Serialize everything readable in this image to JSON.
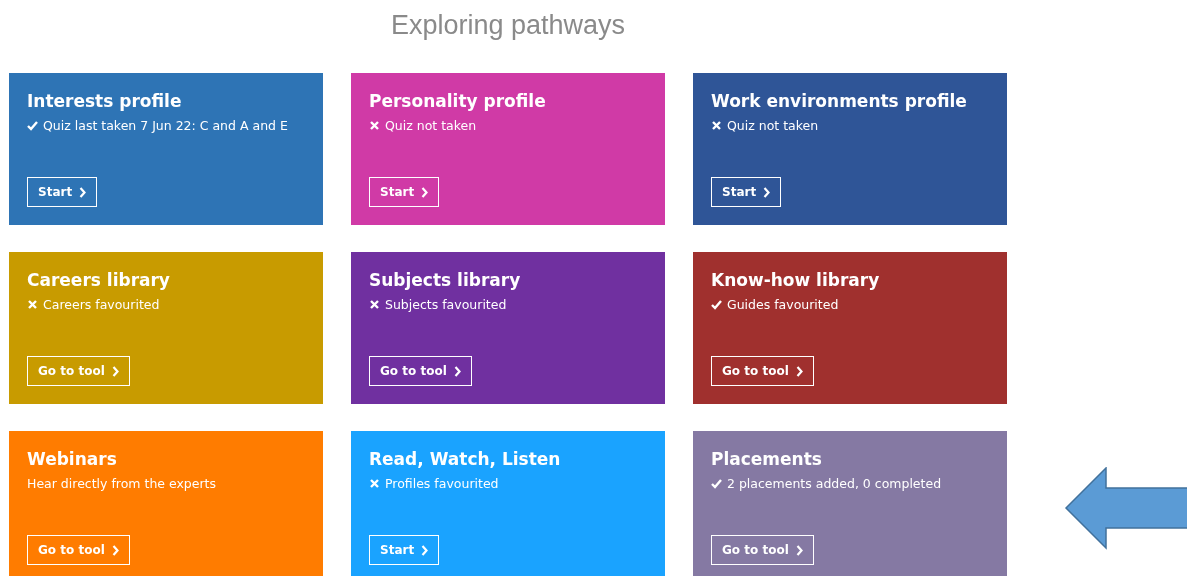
{
  "page_title": "Exploring pathways",
  "cards": [
    {
      "title": "Interests profile",
      "kind": "check",
      "status": "Quiz last taken 7 Jun 22: C and A and E",
      "button": "Start",
      "color": "#2e74b5"
    },
    {
      "title": "Personality profile",
      "kind": "cross",
      "status": "Quiz not taken",
      "button": "Start",
      "color": "#d03aa6"
    },
    {
      "title": "Work environments profile",
      "kind": "cross",
      "status": "Quiz not taken",
      "button": "Start",
      "color": "#2f5597"
    },
    {
      "title": "Careers library",
      "kind": "cross",
      "status": "Careers favourited",
      "button": "Go to tool",
      "color": "#c89b00"
    },
    {
      "title": "Subjects library",
      "kind": "cross",
      "status": "Subjects favourited",
      "button": "Go to tool",
      "color": "#7030a0"
    },
    {
      "title": "Know-how library",
      "kind": "check",
      "status": "Guides favourited",
      "button": "Go to tool",
      "color": "#a0302e"
    },
    {
      "title": "Webinars",
      "kind": "plain",
      "status": "Hear directly from the experts",
      "button": "Go to tool",
      "color": "#ff7c00"
    },
    {
      "title": "Read, Watch, Listen",
      "kind": "cross",
      "status": "Profiles favourited",
      "button": "Start",
      "color": "#1aa3ff"
    },
    {
      "title": "Placements",
      "kind": "check",
      "status": "2 placements added, 0 completed",
      "button": "Go to tool",
      "color": "#8579a3"
    }
  ]
}
